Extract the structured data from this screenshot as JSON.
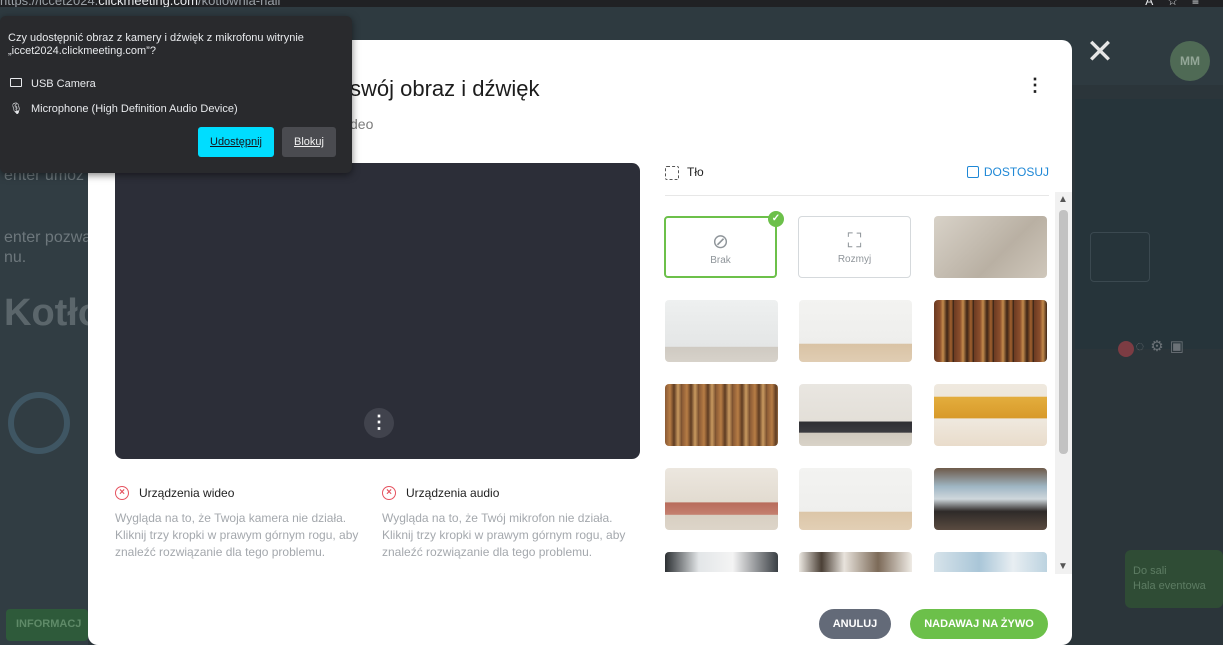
{
  "browser": {
    "url_prefix": "https://iccet2024.",
    "url_host": "clickmeeting.com",
    "url_path": "/kotlownia-hall"
  },
  "permission_popup": {
    "question": "Czy udostępnić obraz z kamery i dźwięk z mikrofonu witrynie „iccet2024.clickmeeting.com”?",
    "camera_label": "USB Camera",
    "microphone_label": "Microphone (High Definition Audio Device)",
    "allow_label": "Udostępnij",
    "block_label": "Blokuj"
  },
  "background_app": {
    "text1": "enter umoż",
    "text2": "enter pozwa",
    "text3": "nu.",
    "big_title": "Kotło",
    "info_button": "INFORMACJ",
    "avatar": "MM",
    "toast_line1": "Do sali",
    "toast_line2": "Hala eventowa"
  },
  "modal": {
    "title": "swój obraz i dźwięk",
    "subtitle": "deo",
    "background": {
      "label": "Tło",
      "adjust_label": "DOSTOSUJ",
      "none_label": "Brak",
      "blur_label": "Rozmyj",
      "selected": "Brak"
    },
    "video_devices": {
      "title": "Urządzenia wideo",
      "description": "Wygląda na to, że Twoja kamera nie działa. Kliknij trzy kropki w prawym górnym rogu, aby znaleźć rozwiązanie dla tego problemu."
    },
    "audio_devices": {
      "title": "Urządzenia audio",
      "description": "Wygląda na to, że Twój mikrofon nie działa. Kliknij trzy kropki w prawym górnym rogu, aby znaleźć rozwiązanie dla tego problemu."
    },
    "cancel_label": "ANULUJ",
    "go_live_label": "NADAWAJ NA ŻYWO"
  },
  "colors": {
    "accent_green": "#6cc04a",
    "accent_blue": "#1f88d6",
    "error_red": "#e5525f",
    "allow_cyan": "#00ddff"
  }
}
